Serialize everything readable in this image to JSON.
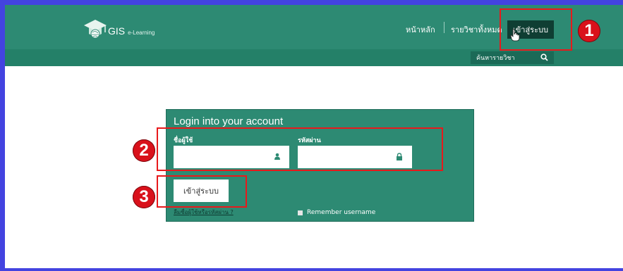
{
  "header": {
    "logo_text": "GIS",
    "logo_sub": "e-Learning",
    "nav_home": "หน้าหลัก",
    "nav_courses": "รายวิชาทั้งหมด",
    "login_button": "เข้าสู่ระบบ"
  },
  "search": {
    "placeholder": "ค้นหารายวิชา"
  },
  "login_panel": {
    "title": "Login into your account",
    "username_label": "ชื่อผู้ใช้",
    "password_label": "รหัสผ่าน",
    "username_value": "",
    "password_value": "",
    "submit_label": "เข้าสู่ระบบ",
    "forgot_link": "ลืมชื่อผู้ใช้หรือรหัสผ่าน ?",
    "remember_label": "Remember username"
  },
  "annotations": {
    "step1": "1",
    "step2": "2",
    "step3": "3"
  },
  "colors": {
    "header_green": "#2d8a73",
    "dark_button": "#0f3e33",
    "highlight_red": "#e8191b",
    "frame_blue": "#4343e0"
  }
}
